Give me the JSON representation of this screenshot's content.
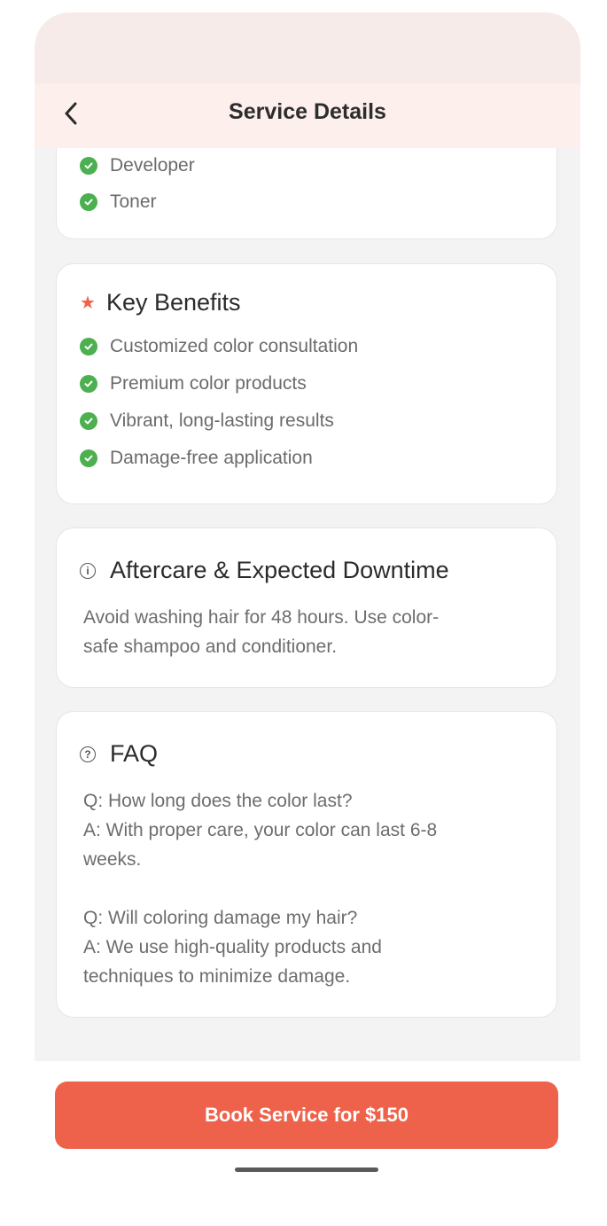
{
  "header": {
    "title": "Service Details",
    "back_icon": "chevron-left-icon"
  },
  "materials": {
    "items": [
      "Developer",
      "Toner"
    ]
  },
  "benefits": {
    "title": "Key Benefits",
    "icon": "star-icon",
    "items": [
      "Customized color consultation",
      "Premium color products",
      "Vibrant, long-lasting results",
      "Damage-free application"
    ]
  },
  "aftercare": {
    "title": "Aftercare & Expected Downtime",
    "icon": "info-icon",
    "text": "Avoid washing hair for 48 hours. Use color-\nsafe shampoo and conditioner."
  },
  "faq": {
    "title": "FAQ",
    "icon": "question-icon",
    "text": "Q: How long does the color last?\nA: With proper care, your color can last 6-8\nweeks.\n\nQ: Will coloring damage my hair?\nA: We use high-quality products and\ntechniques to minimize damage."
  },
  "footer": {
    "book_label": "Book Service for $150"
  },
  "colors": {
    "accent": "#ee624b",
    "check": "#4caf50",
    "header_bg": "#fcefec"
  }
}
